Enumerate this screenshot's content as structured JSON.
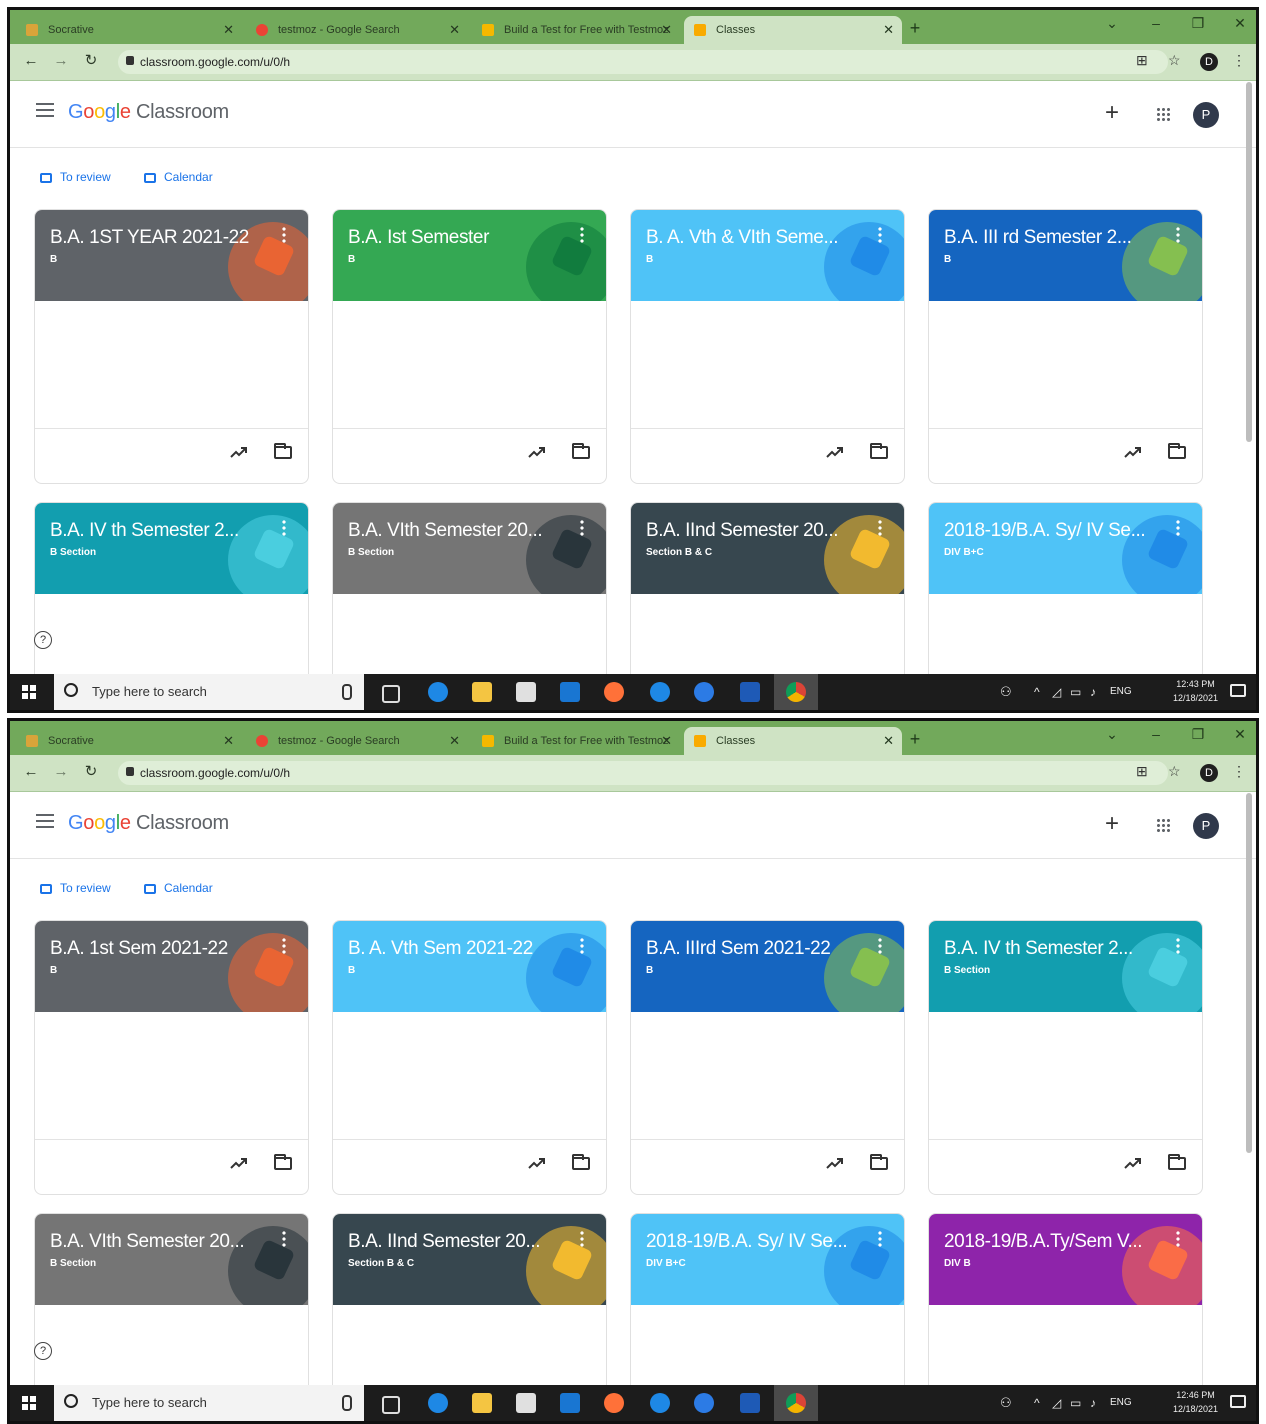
{
  "screenshots": [
    {
      "browser": {
        "tabs": [
          {
            "label": "Socrative",
            "active": false
          },
          {
            "label": "testmoz - Google Search",
            "active": false
          },
          {
            "label": "Build a Test for Free with Testmoz",
            "active": false
          },
          {
            "label": "Classes",
            "active": true
          }
        ],
        "url": "classroom.google.com/u/0/h"
      },
      "header": {
        "brand_google": "Google",
        "brand_product": "Classroom",
        "avatar_letter": "P"
      },
      "actions": {
        "to_review": "To review",
        "calendar": "Calendar"
      },
      "cards": [
        {
          "title": "B.A. 1ST YEAR 2021-22",
          "section": "B",
          "color": "#5f6368",
          "accent": "#f06431"
        },
        {
          "title": "B.A. Ist Semester",
          "section": "B",
          "color": "#34a853",
          "accent": "#0f7a3d"
        },
        {
          "title": "B. A. Vth & VIth Seme...",
          "section": "B",
          "color": "#4fc3f7",
          "accent": "#1e88e5"
        },
        {
          "title": "B.A. III rd Semester 2...",
          "section": "B",
          "color": "#1565c0",
          "accent": "#8bc34a"
        },
        {
          "title": "B.A. IV th Semester 2...",
          "section": "B Section",
          "color": "#129eaf",
          "accent": "#4dd0e1"
        },
        {
          "title": "B.A. VIth Semester 20...",
          "section": "B Section",
          "color": "#757575",
          "accent": "#263238"
        },
        {
          "title": "B.A. IInd Semester 20...",
          "section": "Section B & C",
          "color": "#37474f",
          "accent": "#fbc02d"
        },
        {
          "title": "2018-19/B.A. Sy/ IV Se...",
          "section": "DIV B+C",
          "color": "#4fc3f7",
          "accent": "#1e88e5"
        }
      ],
      "taskbar": {
        "search_placeholder": "Type here to search",
        "lang": "ENG",
        "time": "12:43 PM",
        "date": "12/18/2021"
      }
    },
    {
      "browser": {
        "tabs": [
          {
            "label": "Socrative",
            "active": false
          },
          {
            "label": "testmoz - Google Search",
            "active": false
          },
          {
            "label": "Build a Test for Free with Testmoz",
            "active": false
          },
          {
            "label": "Classes",
            "active": true
          }
        ],
        "url": "classroom.google.com/u/0/h"
      },
      "header": {
        "brand_google": "Google",
        "brand_product": "Classroom",
        "avatar_letter": "P"
      },
      "actions": {
        "to_review": "To review",
        "calendar": "Calendar"
      },
      "cards": [
        {
          "title": "B.A. 1st Sem 2021-22",
          "section": "B",
          "color": "#5f6368",
          "accent": "#f06431"
        },
        {
          "title": "B. A. Vth Sem 2021-22",
          "section": "B",
          "color": "#4fc3f7",
          "accent": "#1e88e5"
        },
        {
          "title": "B.A. IIIrd Sem 2021-22",
          "section": "B",
          "color": "#1565c0",
          "accent": "#8bc34a"
        },
        {
          "title": "B.A. IV th Semester 2...",
          "section": "B Section",
          "color": "#129eaf",
          "accent": "#4dd0e1"
        },
        {
          "title": "B.A. VIth Semester 20...",
          "section": "B Section",
          "color": "#757575",
          "accent": "#263238"
        },
        {
          "title": "B.A. IInd Semester 20...",
          "section": "Section B & C",
          "color": "#37474f",
          "accent": "#fbc02d"
        },
        {
          "title": "2018-19/B.A. Sy/ IV Se...",
          "section": "DIV B+C",
          "color": "#4fc3f7",
          "accent": "#1e88e5"
        },
        {
          "title": "2018-19/B.A.Ty/Sem V...",
          "section": "DIV B",
          "color": "#8e24aa",
          "accent": "#ff7043"
        }
      ],
      "taskbar": {
        "search_placeholder": "Type here to search",
        "lang": "ENG",
        "time": "12:46 PM",
        "date": "12/18/2021"
      }
    }
  ]
}
